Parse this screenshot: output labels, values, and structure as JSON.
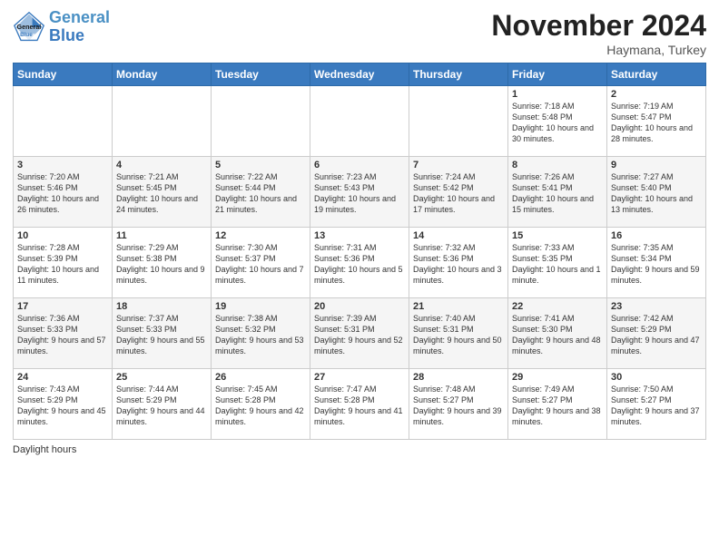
{
  "header": {
    "logo_line1": "General",
    "logo_line2": "Blue",
    "month_title": "November 2024",
    "location": "Haymana, Turkey"
  },
  "days_of_week": [
    "Sunday",
    "Monday",
    "Tuesday",
    "Wednesday",
    "Thursday",
    "Friday",
    "Saturday"
  ],
  "weeks": [
    [
      {
        "day": "",
        "info": ""
      },
      {
        "day": "",
        "info": ""
      },
      {
        "day": "",
        "info": ""
      },
      {
        "day": "",
        "info": ""
      },
      {
        "day": "",
        "info": ""
      },
      {
        "day": "1",
        "info": "Sunrise: 7:18 AM\nSunset: 5:48 PM\nDaylight: 10 hours and 30 minutes."
      },
      {
        "day": "2",
        "info": "Sunrise: 7:19 AM\nSunset: 5:47 PM\nDaylight: 10 hours and 28 minutes."
      }
    ],
    [
      {
        "day": "3",
        "info": "Sunrise: 7:20 AM\nSunset: 5:46 PM\nDaylight: 10 hours and 26 minutes."
      },
      {
        "day": "4",
        "info": "Sunrise: 7:21 AM\nSunset: 5:45 PM\nDaylight: 10 hours and 24 minutes."
      },
      {
        "day": "5",
        "info": "Sunrise: 7:22 AM\nSunset: 5:44 PM\nDaylight: 10 hours and 21 minutes."
      },
      {
        "day": "6",
        "info": "Sunrise: 7:23 AM\nSunset: 5:43 PM\nDaylight: 10 hours and 19 minutes."
      },
      {
        "day": "7",
        "info": "Sunrise: 7:24 AM\nSunset: 5:42 PM\nDaylight: 10 hours and 17 minutes."
      },
      {
        "day": "8",
        "info": "Sunrise: 7:26 AM\nSunset: 5:41 PM\nDaylight: 10 hours and 15 minutes."
      },
      {
        "day": "9",
        "info": "Sunrise: 7:27 AM\nSunset: 5:40 PM\nDaylight: 10 hours and 13 minutes."
      }
    ],
    [
      {
        "day": "10",
        "info": "Sunrise: 7:28 AM\nSunset: 5:39 PM\nDaylight: 10 hours and 11 minutes."
      },
      {
        "day": "11",
        "info": "Sunrise: 7:29 AM\nSunset: 5:38 PM\nDaylight: 10 hours and 9 minutes."
      },
      {
        "day": "12",
        "info": "Sunrise: 7:30 AM\nSunset: 5:37 PM\nDaylight: 10 hours and 7 minutes."
      },
      {
        "day": "13",
        "info": "Sunrise: 7:31 AM\nSunset: 5:36 PM\nDaylight: 10 hours and 5 minutes."
      },
      {
        "day": "14",
        "info": "Sunrise: 7:32 AM\nSunset: 5:36 PM\nDaylight: 10 hours and 3 minutes."
      },
      {
        "day": "15",
        "info": "Sunrise: 7:33 AM\nSunset: 5:35 PM\nDaylight: 10 hours and 1 minute."
      },
      {
        "day": "16",
        "info": "Sunrise: 7:35 AM\nSunset: 5:34 PM\nDaylight: 9 hours and 59 minutes."
      }
    ],
    [
      {
        "day": "17",
        "info": "Sunrise: 7:36 AM\nSunset: 5:33 PM\nDaylight: 9 hours and 57 minutes."
      },
      {
        "day": "18",
        "info": "Sunrise: 7:37 AM\nSunset: 5:33 PM\nDaylight: 9 hours and 55 minutes."
      },
      {
        "day": "19",
        "info": "Sunrise: 7:38 AM\nSunset: 5:32 PM\nDaylight: 9 hours and 53 minutes."
      },
      {
        "day": "20",
        "info": "Sunrise: 7:39 AM\nSunset: 5:31 PM\nDaylight: 9 hours and 52 minutes."
      },
      {
        "day": "21",
        "info": "Sunrise: 7:40 AM\nSunset: 5:31 PM\nDaylight: 9 hours and 50 minutes."
      },
      {
        "day": "22",
        "info": "Sunrise: 7:41 AM\nSunset: 5:30 PM\nDaylight: 9 hours and 48 minutes."
      },
      {
        "day": "23",
        "info": "Sunrise: 7:42 AM\nSunset: 5:29 PM\nDaylight: 9 hours and 47 minutes."
      }
    ],
    [
      {
        "day": "24",
        "info": "Sunrise: 7:43 AM\nSunset: 5:29 PM\nDaylight: 9 hours and 45 minutes."
      },
      {
        "day": "25",
        "info": "Sunrise: 7:44 AM\nSunset: 5:29 PM\nDaylight: 9 hours and 44 minutes."
      },
      {
        "day": "26",
        "info": "Sunrise: 7:45 AM\nSunset: 5:28 PM\nDaylight: 9 hours and 42 minutes."
      },
      {
        "day": "27",
        "info": "Sunrise: 7:47 AM\nSunset: 5:28 PM\nDaylight: 9 hours and 41 minutes."
      },
      {
        "day": "28",
        "info": "Sunrise: 7:48 AM\nSunset: 5:27 PM\nDaylight: 9 hours and 39 minutes."
      },
      {
        "day": "29",
        "info": "Sunrise: 7:49 AM\nSunset: 5:27 PM\nDaylight: 9 hours and 38 minutes."
      },
      {
        "day": "30",
        "info": "Sunrise: 7:50 AM\nSunset: 5:27 PM\nDaylight: 9 hours and 37 minutes."
      }
    ]
  ],
  "legend": {
    "daylight_hours": "Daylight hours"
  }
}
